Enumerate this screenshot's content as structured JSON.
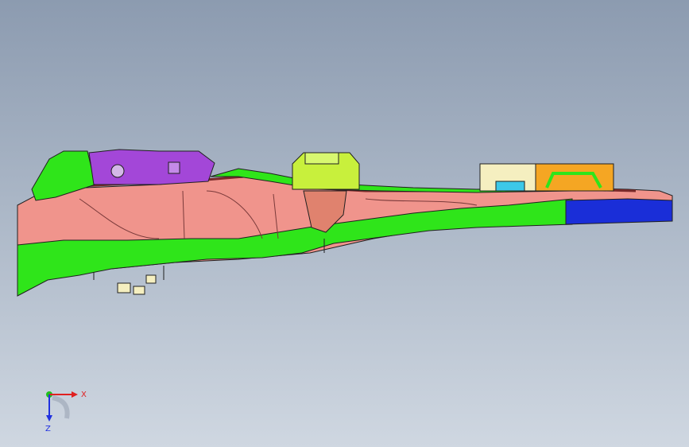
{
  "viewport": {
    "background_top": "#8c9bb0",
    "background_bottom": "#cfd7e1"
  },
  "model": {
    "part_colors": {
      "frame": "#f0948c",
      "lower_rail": "#2fe51a",
      "bracket_purple": "#a347d8",
      "bracket_lime": "#c8f03c",
      "block_cream": "#f5efc0",
      "block_orange": "#f5a623",
      "end_blue": "#1a2ed8",
      "clip_cyan": "#3cc8e8",
      "edge": "#202020"
    }
  },
  "triad": {
    "x_label": "X",
    "z_label": "Z",
    "x_color": "#e02020",
    "y_color": "#20c020",
    "z_color": "#2030e0"
  }
}
